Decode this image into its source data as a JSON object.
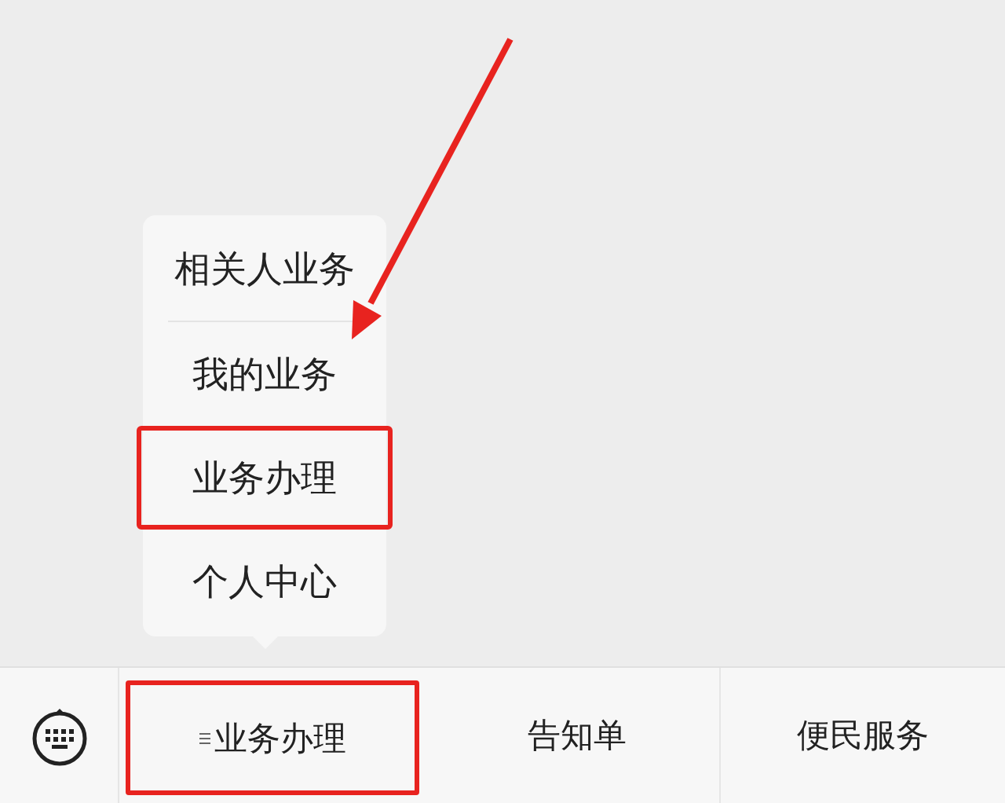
{
  "popup_menu": {
    "items": [
      {
        "label": "相关人业务",
        "highlighted": false
      },
      {
        "label": "我的业务",
        "highlighted": false
      },
      {
        "label": "业务办理",
        "highlighted": true
      },
      {
        "label": "个人中心",
        "highlighted": false
      }
    ]
  },
  "bottom_bar": {
    "tabs": [
      {
        "label": "业务办理",
        "kind": "menu",
        "highlighted": true
      },
      {
        "label": "告知单",
        "kind": "plain",
        "highlighted": false
      },
      {
        "label": "便民服务",
        "kind": "plain",
        "highlighted": false
      }
    ]
  },
  "annotation": {
    "kind": "arrow"
  }
}
